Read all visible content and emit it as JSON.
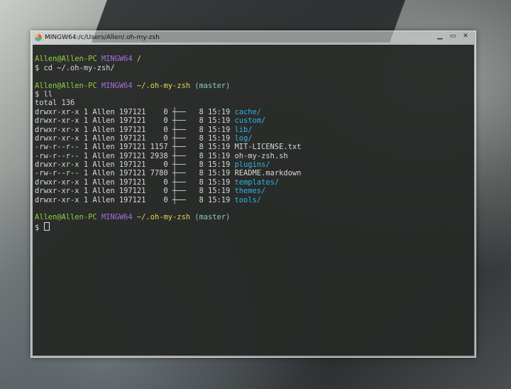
{
  "window": {
    "title": "MINGW64:/c/Users/Allen/.oh-my-zsh",
    "controls": [
      "minimize",
      "maximize",
      "close"
    ]
  },
  "colors": {
    "user": "#8fd23a",
    "host_tag": "#a66ed8",
    "path": "#e8d44d",
    "branch": "#8ec8c4",
    "dir": "#2eb3e6"
  },
  "prompts": [
    {
      "user": "Allen@Allen-PC",
      "tag": "MINGW64",
      "path": "/",
      "branch": "",
      "command": "$ cd ~/.oh-my-zsh/"
    },
    {
      "user": "Allen@Allen-PC",
      "tag": "MINGW64",
      "path": "~/.oh-my-zsh",
      "branch": "(master)",
      "command": "$ ll"
    },
    {
      "user": "Allen@Allen-PC",
      "tag": "MINGW64",
      "path": "~/.oh-my-zsh",
      "branch": "(master)",
      "command": "$ "
    }
  ],
  "total": "total 136",
  "listing": [
    {
      "meta": "drwxr-xr-x 1 Allen 197121    0 ┼──   8 15:19 ",
      "name": "cache/",
      "dir": true
    },
    {
      "meta": "drwxr-xr-x 1 Allen 197121    0 ┼──   8 15:19 ",
      "name": "custom/",
      "dir": true
    },
    {
      "meta": "drwxr-xr-x 1 Allen 197121    0 ┼──   8 15:19 ",
      "name": "lib/",
      "dir": true
    },
    {
      "meta": "drwxr-xr-x 1 Allen 197121    0 ┼──   8 15:19 ",
      "name": "log/",
      "dir": true
    },
    {
      "meta": "-rw-r--r-- 1 Allen 197121 1157 ┼──   8 15:19 ",
      "name": "MIT-LICENSE.txt",
      "dir": false
    },
    {
      "meta": "-rw-r--r-- 1 Allen 197121 2938 ┼──   8 15:19 ",
      "name": "oh-my-zsh.sh",
      "dir": false
    },
    {
      "meta": "drwxr-xr-x 1 Allen 197121    0 ┼──   8 15:19 ",
      "name": "plugins/",
      "dir": true
    },
    {
      "meta": "-rw-r--r-- 1 Allen 197121 7780 ┼──   8 15:19 ",
      "name": "README.markdown",
      "dir": false
    },
    {
      "meta": "drwxr-xr-x 1 Allen 197121    0 ┼──   8 15:19 ",
      "name": "templates/",
      "dir": true
    },
    {
      "meta": "drwxr-xr-x 1 Allen 197121    0 ┼──   8 15:19 ",
      "name": "themes/",
      "dir": true
    },
    {
      "meta": "drwxr-xr-x 1 Allen 197121    0 ┼──   8 15:19 ",
      "name": "tools/",
      "dir": true
    }
  ]
}
